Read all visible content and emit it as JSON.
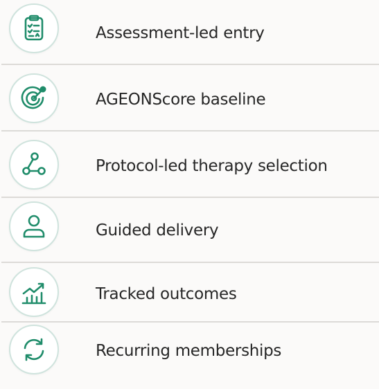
{
  "accent_color": "#1f8c6a",
  "items": [
    {
      "label": "Assessment-led entry",
      "icon": "clipboard-checklist-icon"
    },
    {
      "label": "AGEONScore baseline",
      "icon": "target-dart-icon"
    },
    {
      "label": "Protocol-led therapy selection",
      "icon": "node-network-icon"
    },
    {
      "label": "Guided delivery",
      "icon": "person-icon"
    },
    {
      "label": "Tracked outcomes",
      "icon": "growth-chart-icon"
    },
    {
      "label": "Recurring memberships",
      "icon": "refresh-cycle-icon"
    }
  ]
}
